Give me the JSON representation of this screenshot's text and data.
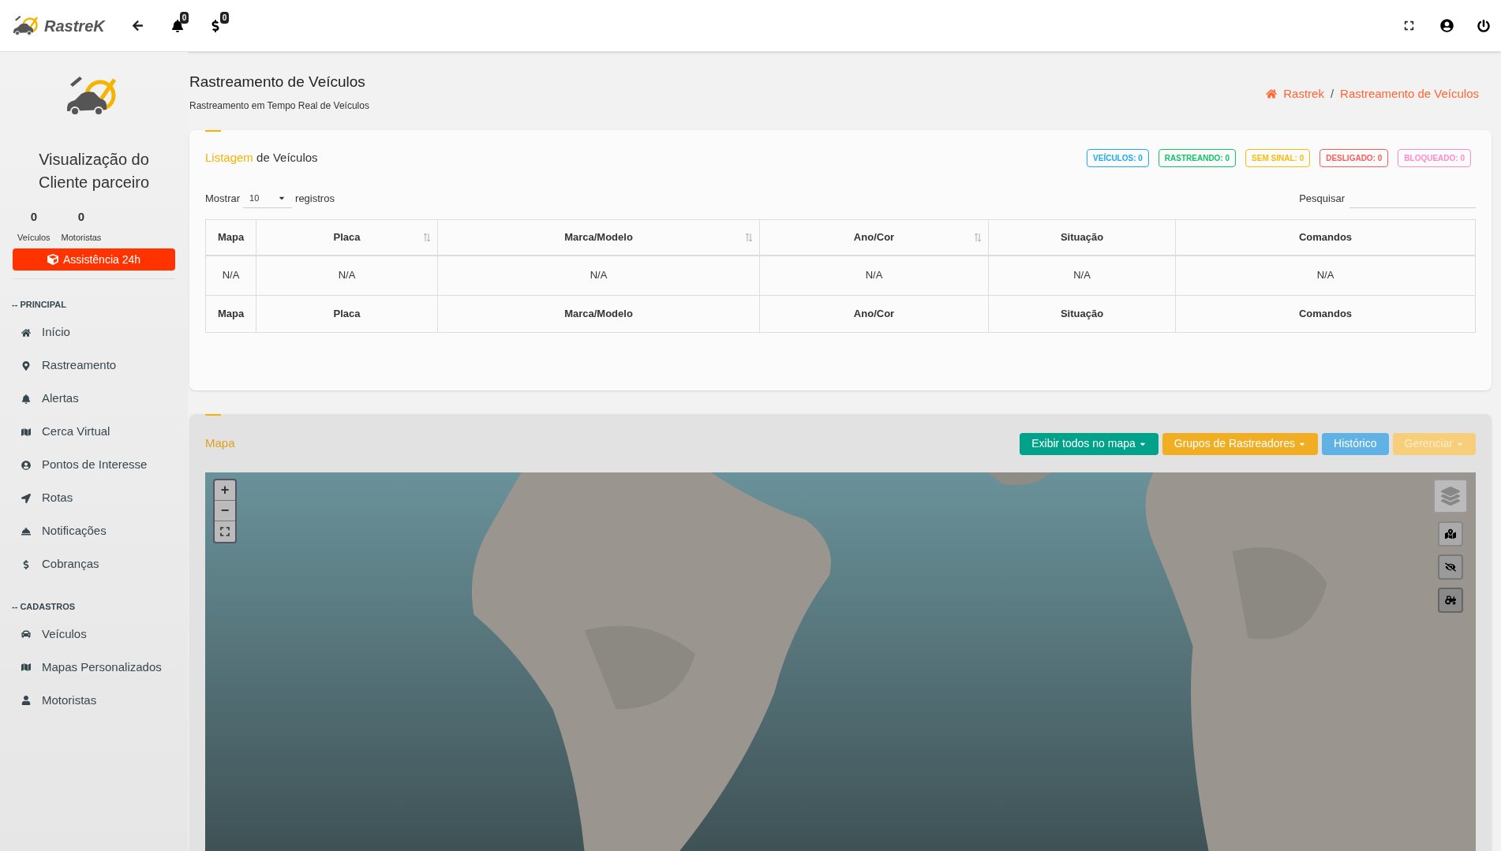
{
  "header": {
    "brand": "RastreK",
    "notifications": {
      "count": "0"
    },
    "billing": {
      "count": "0"
    }
  },
  "sidebar": {
    "profile": {
      "title": "Visualização do Cliente parceiro",
      "stats": [
        {
          "value": "0",
          "label": "Veículos"
        },
        {
          "value": "0",
          "label": "Motoristas"
        }
      ],
      "assist_button": "Assistência 24h"
    },
    "sections": [
      {
        "title": "-- PRINCIPAL",
        "items": [
          {
            "label": "Início"
          },
          {
            "label": "Rastreamento"
          },
          {
            "label": "Alertas"
          },
          {
            "label": "Cerca Virtual"
          },
          {
            "label": "Pontos de Interesse"
          },
          {
            "label": "Rotas"
          },
          {
            "label": "Notificações"
          },
          {
            "label": "Cobranças"
          }
        ]
      },
      {
        "title": "-- CADASTROS",
        "items": [
          {
            "label": "Veículos"
          },
          {
            "label": "Mapas Personalizados"
          },
          {
            "label": "Motoristas"
          }
        ]
      }
    ]
  },
  "page": {
    "title": "Rastreamento de Veículos",
    "subtitle": "Rastreamento em Tempo Real de Veículos",
    "breadcrumb": [
      "Rastrek",
      "Rastreamento de Veículos"
    ],
    "breadcrumb_separator": "/"
  },
  "listing": {
    "title_highlight": "Listagem",
    "title_rest": "de Veículos",
    "badges": [
      {
        "label": "VEÍCULOS: 0",
        "color": "#1eaaf1"
      },
      {
        "label": "RASTREANDO: 0",
        "color": "#10c469"
      },
      {
        "label": "SEM SINAL: 0",
        "color": "#f9bc0b"
      },
      {
        "label": "DESLIGADO: 0",
        "color": "#ff5b5b"
      },
      {
        "label": "BLOQUEADO: 0",
        "color": "#ff8acc"
      }
    ],
    "show_label": "Mostrar",
    "page_size": "10",
    "records_label": "registros",
    "search_label": "Pesquisar",
    "table": {
      "columns": [
        {
          "label": "Mapa",
          "sortable": false
        },
        {
          "label": "Placa",
          "sortable": true
        },
        {
          "label": "Marca/Modelo",
          "sortable": true
        },
        {
          "label": "Ano/Cor",
          "sortable": true
        },
        {
          "label": "Situação",
          "sortable": false
        },
        {
          "label": "Comandos",
          "sortable": false
        }
      ],
      "rows": [
        [
          "N/A",
          "N/A",
          "N/A",
          "N/A",
          "N/A",
          "N/A"
        ]
      ],
      "footer": [
        "Mapa",
        "Placa",
        "Marca/Modelo",
        "Ano/Cor",
        "Situação",
        "Comandos"
      ]
    }
  },
  "map_panel": {
    "title": "Mapa",
    "buttons": [
      {
        "label": "Exibir todos no mapa",
        "color": "#00a28a",
        "dropdown": true,
        "disabled": false
      },
      {
        "label": "Grupos de Rastreadores",
        "color": "#f2ae22",
        "dropdown": true,
        "disabled": false
      },
      {
        "label": "Histórico",
        "color": "#5fb2e3",
        "dropdown": false,
        "disabled": false
      },
      {
        "label": "Gerenciar",
        "color": "#f7cf7a",
        "dropdown": true,
        "disabled": true
      }
    ],
    "zoom_in": "+",
    "zoom_out": "−"
  }
}
